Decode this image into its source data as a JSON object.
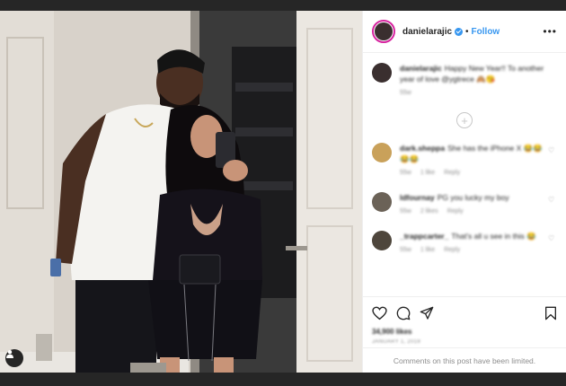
{
  "post": {
    "username": "danielarajic",
    "follow_label": "Follow",
    "separator": "•",
    "more_label": "•••",
    "caption": {
      "username": "danielarajic",
      "text": "Happy New Year!! To another year of love @ygtrece 🙈😘",
      "age": "55w"
    },
    "comments": [
      {
        "username": "dark.sheppa",
        "text": "She has the iPhone X 😂😂😂😂",
        "age": "55w",
        "likes": "1 like",
        "reply": "Reply"
      },
      {
        "username": "ldfournay",
        "text": "PG you lucky my boy",
        "age": "55w",
        "likes": "2 likes",
        "reply": "Reply"
      },
      {
        "username": "_trappcarter_",
        "text": "That's all u see in this 😂",
        "age": "55w",
        "likes": "1 like",
        "reply": "Reply"
      }
    ],
    "likes_count": "34,900 likes",
    "date": "JANUARY 1, 2019",
    "comments_limited": "Comments on this post have been limited."
  },
  "icons": [
    "heart-icon",
    "comment-icon",
    "share-icon",
    "bookmark-icon",
    "user-icon",
    "plus-circle-icon"
  ],
  "colors": {
    "accent": "#3897f0",
    "panel_bg": "#ffffff",
    "backdrop": "#262626",
    "muted": "#8e8e8e"
  }
}
